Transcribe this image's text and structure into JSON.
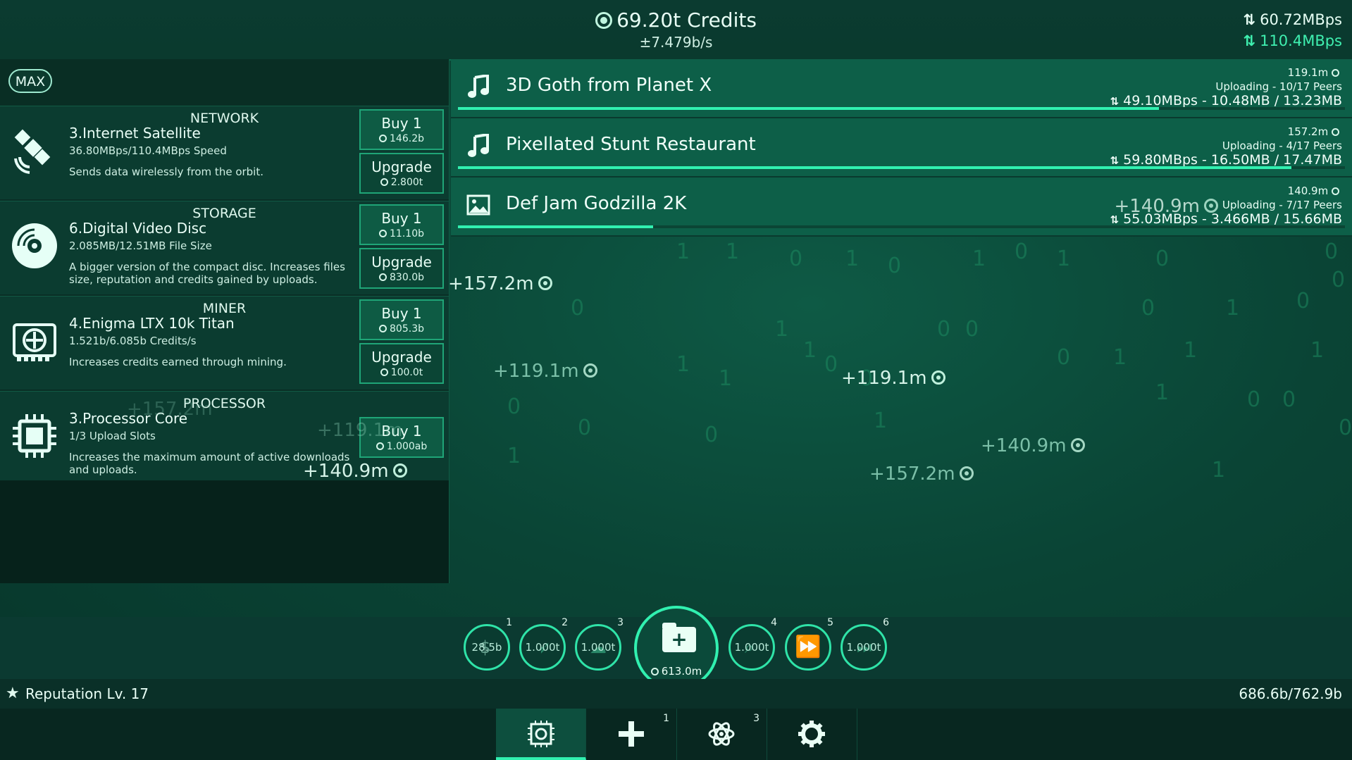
{
  "header": {
    "credits": "69.20t Credits",
    "rate": "±7.479b/s",
    "upload_speed": "60.72MBps",
    "download_speed": "110.4MBps"
  },
  "left_panel": {
    "max_label": "MAX",
    "cards": [
      {
        "category": "NETWORK",
        "name": "3.Internet Satellite",
        "stat": "36.80MBps/110.4MBps Speed",
        "description": "Sends data wirelessly from the orbit.",
        "buy_label": "Buy 1",
        "buy_price": "146.2b",
        "upgrade_label": "Upgrade",
        "upgrade_price": "2.800t",
        "icon": "satellite-icon"
      },
      {
        "category": "STORAGE",
        "name": "6.Digital Video Disc",
        "stat": "2.085MB/12.51MB File Size",
        "description": "A bigger version of the compact disc. Increases files size, reputation and credits gained by uploads.",
        "buy_label": "Buy 1",
        "buy_price": "11.10b",
        "upgrade_label": "Upgrade",
        "upgrade_price": "830.0b",
        "icon": "disc-icon"
      },
      {
        "category": "MINER",
        "name": "4.Enigma LTX 10k Titan",
        "stat": "1.521b/6.085b Credits/s",
        "description": "Increases credits earned through mining.",
        "buy_label": "Buy 1",
        "buy_price": "805.3b",
        "upgrade_label": "Upgrade",
        "upgrade_price": "100.0t",
        "icon": "gpu-icon"
      },
      {
        "category": "PROCESSOR",
        "name": "3.Processor Core",
        "stat": "1/3 Upload Slots",
        "description": "Increases the maximum amount of active downloads and uploads.",
        "buy_label": "Buy 1",
        "buy_price": "1.000ab",
        "icon": "cpu-icon"
      }
    ]
  },
  "uploads": [
    {
      "title": "3D Goth from Planet X",
      "amount": "119.1m",
      "status": "Uploading - 10/17 Peers",
      "transfer": "49.10MBps - 10.48MB / 13.23MB",
      "progress": 0.79,
      "icon": "music-note-icon"
    },
    {
      "title": "Pixellated Stunt Restaurant",
      "amount": "157.2m",
      "status": "Uploading - 4/17 Peers",
      "transfer": "59.80MBps - 16.50MB / 17.47MB",
      "progress": 0.94,
      "icon": "music-note-icon"
    },
    {
      "title": "Def Jam Godzilla 2K",
      "amount": "140.9m",
      "status": "Uploading - 7/17 Peers",
      "transfer": "55.03MBps - 3.466MB / 15.66MB",
      "progress": 0.22,
      "icon": "image-icon",
      "inline_gain": "+140.9m"
    }
  ],
  "floating_gains": [
    "+157.2m",
    "+119.1m",
    "+119.1m",
    "+140.9m",
    "+157.2m",
    "+140.9m",
    "+119.1m",
    "+157.2m"
  ],
  "action_bar": {
    "boosts": [
      {
        "slot": "1",
        "price": "28.5b",
        "icon": "money-bag-icon"
      },
      {
        "slot": "2",
        "price": "1.000t",
        "icon": "rocket-icon"
      },
      {
        "slot": "3",
        "price": "1.000t",
        "icon": "cloud-icon"
      },
      {
        "slot": "4",
        "price": "1.000t",
        "icon": "magnifier-icon"
      },
      {
        "slot": "5",
        "price": "",
        "icon": "fast-forward-icon"
      },
      {
        "slot": "6",
        "price": "1.000t",
        "icon": "skip-icon"
      }
    ],
    "new_file_cost": "613.0m"
  },
  "reputation": {
    "label": "Reputation Lv. 17",
    "value": "686.6b/762.9b",
    "progress": 0.9
  },
  "nav": {
    "tabs": [
      {
        "name": "hardware",
        "badge": ""
      },
      {
        "name": "add",
        "badge": "1"
      },
      {
        "name": "research",
        "badge": "3"
      },
      {
        "name": "settings",
        "badge": ""
      }
    ]
  },
  "colors": {
    "accent": "#31f0b0",
    "row_bg": "#0d5f48",
    "panel_bg": "#0b3c30"
  }
}
